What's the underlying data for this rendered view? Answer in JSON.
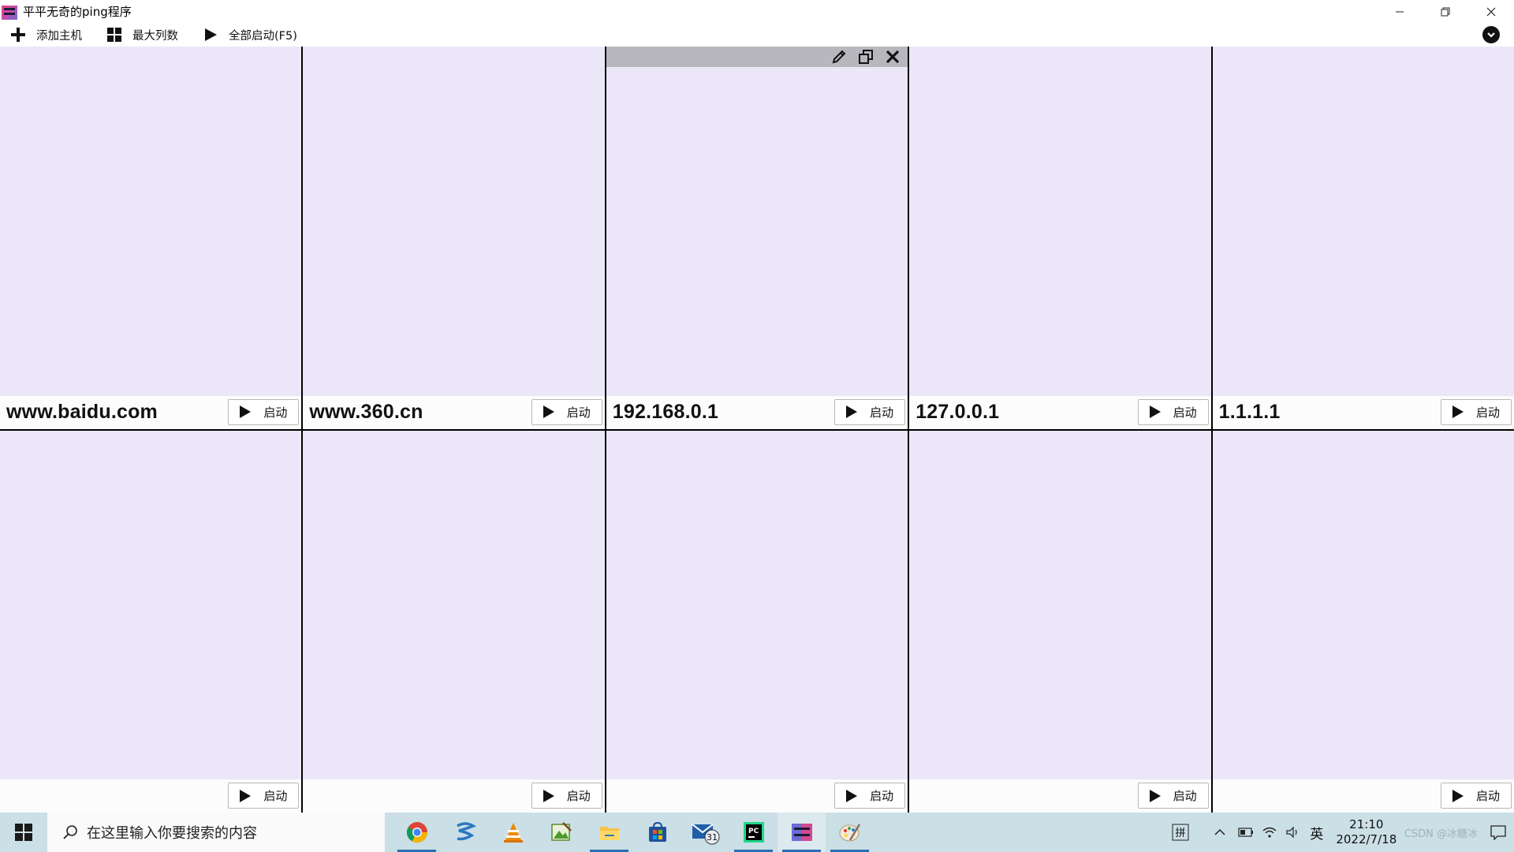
{
  "window": {
    "title": "平平无奇的ping程序",
    "minimize_icon": "minimize-icon",
    "restore_icon": "restore-icon",
    "close_icon": "close-icon"
  },
  "toolbar": {
    "add_host_label": "添加主机",
    "max_columns_label": "最大列数",
    "start_all_label": "全部启动(F5)"
  },
  "grid": {
    "columns": 5,
    "rows": 2,
    "cells": [
      {
        "host": "www.baidu.com",
        "start_label": "启动"
      },
      {
        "host": "www.360.cn",
        "start_label": "启动"
      },
      {
        "host": "192.168.0.1",
        "start_label": "启动",
        "show_header": true
      },
      {
        "host": "127.0.0.1",
        "start_label": "启动"
      },
      {
        "host": "1.1.1.1",
        "start_label": "启动"
      },
      {
        "host": "",
        "start_label": "启动"
      },
      {
        "host": "",
        "start_label": "启动"
      },
      {
        "host": "",
        "start_label": "启动"
      },
      {
        "host": "",
        "start_label": "启动"
      },
      {
        "host": "",
        "start_label": "启动"
      }
    ]
  },
  "taskbar": {
    "search_placeholder": "在这里输入你要搜索的内容",
    "mail_badge": "31",
    "ime_mode": "拼",
    "ime_lang": "英",
    "time": "21:10",
    "date": "2022/7/18",
    "watermark": "CSDN @冰糖冰"
  },
  "colors": {
    "cell_bg": "#ebe7f8",
    "grid_line": "#000000",
    "taskbar_bg": "#cbdfe6",
    "header_bg": "#b9b7be"
  }
}
